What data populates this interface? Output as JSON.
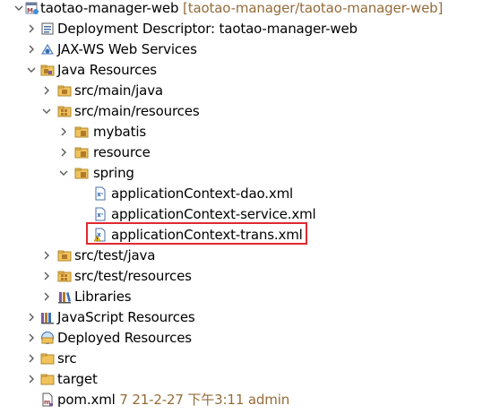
{
  "project": {
    "name": "taotao-manager-web",
    "decoration": "[taotao-manager/taotao-manager-web]",
    "icon": "maven-web-project-icon"
  },
  "items": [
    {
      "label": "Deployment Descriptor: taotao-manager-web",
      "icon": "deployment-descriptor-icon",
      "expander": "collapsed"
    },
    {
      "label": "JAX-WS Web Services",
      "icon": "web-services-icon",
      "expander": "collapsed"
    },
    {
      "label": "Java Resources",
      "icon": "java-resources-icon",
      "expander": "expanded"
    },
    {
      "label": "src/main/java",
      "icon": "source-folder-icon",
      "expander": "collapsed"
    },
    {
      "label": "src/main/resources",
      "icon": "source-folder-icon",
      "expander": "expanded"
    },
    {
      "label": "mybatis",
      "icon": "package-folder-icon",
      "expander": "collapsed"
    },
    {
      "label": "resource",
      "icon": "package-folder-icon",
      "expander": "collapsed"
    },
    {
      "label": "spring",
      "icon": "package-folder-icon",
      "expander": "expanded"
    },
    {
      "label": "applicationContext-dao.xml",
      "icon": "xml-file-icon",
      "expander": "none"
    },
    {
      "label": "applicationContext-service.xml",
      "icon": "xml-file-icon",
      "expander": "none"
    },
    {
      "label": "applicationContext-trans.xml",
      "icon": "xml-file-warning-icon",
      "expander": "none",
      "highlighted": true
    },
    {
      "label": "src/test/java",
      "icon": "source-folder-icon",
      "expander": "collapsed"
    },
    {
      "label": "src/test/resources",
      "icon": "source-folder-icon",
      "expander": "collapsed"
    },
    {
      "label": "Libraries",
      "icon": "libraries-icon",
      "expander": "collapsed"
    },
    {
      "label": "JavaScript Resources",
      "icon": "javascript-resources-icon",
      "expander": "collapsed"
    },
    {
      "label": "Deployed Resources",
      "icon": "deployed-resources-icon",
      "expander": "collapsed"
    },
    {
      "label": "src",
      "icon": "folder-icon",
      "expander": "collapsed"
    },
    {
      "label": "target",
      "icon": "folder-icon",
      "expander": "collapsed"
    },
    {
      "label": "pom.xml",
      "icon": "pom-file-icon",
      "expander": "none",
      "decoration": "7  21-2-27 下午3:11  admin"
    }
  ],
  "colors": {
    "decoration": "#946b39",
    "highlight_border": "#e0292f",
    "folder_yellow": "#f1c35c",
    "package_brown": "#b07a2d"
  }
}
